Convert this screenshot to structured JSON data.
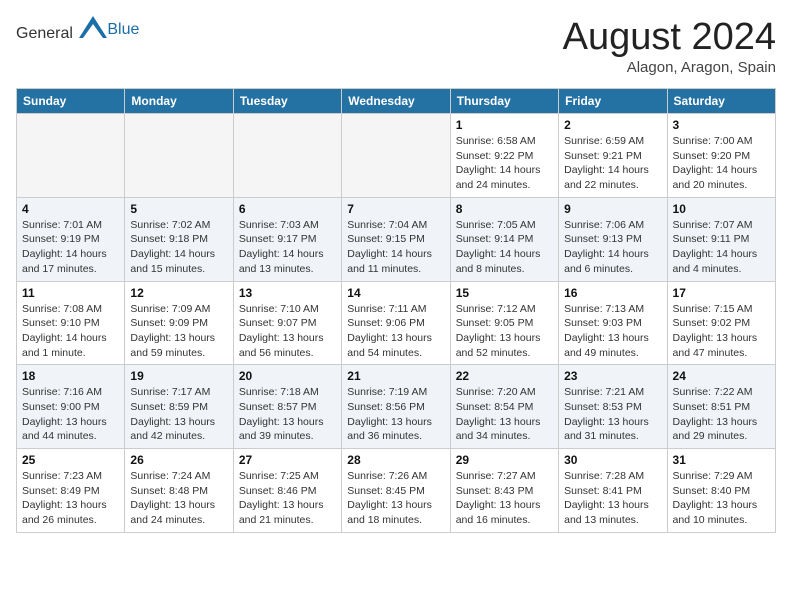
{
  "header": {
    "logo_general": "General",
    "logo_blue": "Blue",
    "month_year": "August 2024",
    "location": "Alagon, Aragon, Spain"
  },
  "days_of_week": [
    "Sunday",
    "Monday",
    "Tuesday",
    "Wednesday",
    "Thursday",
    "Friday",
    "Saturday"
  ],
  "weeks": [
    [
      {
        "day": "",
        "sunrise": "",
        "sunset": "",
        "daylight": "",
        "empty": true
      },
      {
        "day": "",
        "sunrise": "",
        "sunset": "",
        "daylight": "",
        "empty": true
      },
      {
        "day": "",
        "sunrise": "",
        "sunset": "",
        "daylight": "",
        "empty": true
      },
      {
        "day": "",
        "sunrise": "",
        "sunset": "",
        "daylight": "",
        "empty": true
      },
      {
        "day": "1",
        "sunrise": "Sunrise: 6:58 AM",
        "sunset": "Sunset: 9:22 PM",
        "daylight": "Daylight: 14 hours and 24 minutes.",
        "empty": false
      },
      {
        "day": "2",
        "sunrise": "Sunrise: 6:59 AM",
        "sunset": "Sunset: 9:21 PM",
        "daylight": "Daylight: 14 hours and 22 minutes.",
        "empty": false
      },
      {
        "day": "3",
        "sunrise": "Sunrise: 7:00 AM",
        "sunset": "Sunset: 9:20 PM",
        "daylight": "Daylight: 14 hours and 20 minutes.",
        "empty": false
      }
    ],
    [
      {
        "day": "4",
        "sunrise": "Sunrise: 7:01 AM",
        "sunset": "Sunset: 9:19 PM",
        "daylight": "Daylight: 14 hours and 17 minutes.",
        "empty": false
      },
      {
        "day": "5",
        "sunrise": "Sunrise: 7:02 AM",
        "sunset": "Sunset: 9:18 PM",
        "daylight": "Daylight: 14 hours and 15 minutes.",
        "empty": false
      },
      {
        "day": "6",
        "sunrise": "Sunrise: 7:03 AM",
        "sunset": "Sunset: 9:17 PM",
        "daylight": "Daylight: 14 hours and 13 minutes.",
        "empty": false
      },
      {
        "day": "7",
        "sunrise": "Sunrise: 7:04 AM",
        "sunset": "Sunset: 9:15 PM",
        "daylight": "Daylight: 14 hours and 11 minutes.",
        "empty": false
      },
      {
        "day": "8",
        "sunrise": "Sunrise: 7:05 AM",
        "sunset": "Sunset: 9:14 PM",
        "daylight": "Daylight: 14 hours and 8 minutes.",
        "empty": false
      },
      {
        "day": "9",
        "sunrise": "Sunrise: 7:06 AM",
        "sunset": "Sunset: 9:13 PM",
        "daylight": "Daylight: 14 hours and 6 minutes.",
        "empty": false
      },
      {
        "day": "10",
        "sunrise": "Sunrise: 7:07 AM",
        "sunset": "Sunset: 9:11 PM",
        "daylight": "Daylight: 14 hours and 4 minutes.",
        "empty": false
      }
    ],
    [
      {
        "day": "11",
        "sunrise": "Sunrise: 7:08 AM",
        "sunset": "Sunset: 9:10 PM",
        "daylight": "Daylight: 14 hours and 1 minute.",
        "empty": false
      },
      {
        "day": "12",
        "sunrise": "Sunrise: 7:09 AM",
        "sunset": "Sunset: 9:09 PM",
        "daylight": "Daylight: 13 hours and 59 minutes.",
        "empty": false
      },
      {
        "day": "13",
        "sunrise": "Sunrise: 7:10 AM",
        "sunset": "Sunset: 9:07 PM",
        "daylight": "Daylight: 13 hours and 56 minutes.",
        "empty": false
      },
      {
        "day": "14",
        "sunrise": "Sunrise: 7:11 AM",
        "sunset": "Sunset: 9:06 PM",
        "daylight": "Daylight: 13 hours and 54 minutes.",
        "empty": false
      },
      {
        "day": "15",
        "sunrise": "Sunrise: 7:12 AM",
        "sunset": "Sunset: 9:05 PM",
        "daylight": "Daylight: 13 hours and 52 minutes.",
        "empty": false
      },
      {
        "day": "16",
        "sunrise": "Sunrise: 7:13 AM",
        "sunset": "Sunset: 9:03 PM",
        "daylight": "Daylight: 13 hours and 49 minutes.",
        "empty": false
      },
      {
        "day": "17",
        "sunrise": "Sunrise: 7:15 AM",
        "sunset": "Sunset: 9:02 PM",
        "daylight": "Daylight: 13 hours and 47 minutes.",
        "empty": false
      }
    ],
    [
      {
        "day": "18",
        "sunrise": "Sunrise: 7:16 AM",
        "sunset": "Sunset: 9:00 PM",
        "daylight": "Daylight: 13 hours and 44 minutes.",
        "empty": false
      },
      {
        "day": "19",
        "sunrise": "Sunrise: 7:17 AM",
        "sunset": "Sunset: 8:59 PM",
        "daylight": "Daylight: 13 hours and 42 minutes.",
        "empty": false
      },
      {
        "day": "20",
        "sunrise": "Sunrise: 7:18 AM",
        "sunset": "Sunset: 8:57 PM",
        "daylight": "Daylight: 13 hours and 39 minutes.",
        "empty": false
      },
      {
        "day": "21",
        "sunrise": "Sunrise: 7:19 AM",
        "sunset": "Sunset: 8:56 PM",
        "daylight": "Daylight: 13 hours and 36 minutes.",
        "empty": false
      },
      {
        "day": "22",
        "sunrise": "Sunrise: 7:20 AM",
        "sunset": "Sunset: 8:54 PM",
        "daylight": "Daylight: 13 hours and 34 minutes.",
        "empty": false
      },
      {
        "day": "23",
        "sunrise": "Sunrise: 7:21 AM",
        "sunset": "Sunset: 8:53 PM",
        "daylight": "Daylight: 13 hours and 31 minutes.",
        "empty": false
      },
      {
        "day": "24",
        "sunrise": "Sunrise: 7:22 AM",
        "sunset": "Sunset: 8:51 PM",
        "daylight": "Daylight: 13 hours and 29 minutes.",
        "empty": false
      }
    ],
    [
      {
        "day": "25",
        "sunrise": "Sunrise: 7:23 AM",
        "sunset": "Sunset: 8:49 PM",
        "daylight": "Daylight: 13 hours and 26 minutes.",
        "empty": false
      },
      {
        "day": "26",
        "sunrise": "Sunrise: 7:24 AM",
        "sunset": "Sunset: 8:48 PM",
        "daylight": "Daylight: 13 hours and 24 minutes.",
        "empty": false
      },
      {
        "day": "27",
        "sunrise": "Sunrise: 7:25 AM",
        "sunset": "Sunset: 8:46 PM",
        "daylight": "Daylight: 13 hours and 21 minutes.",
        "empty": false
      },
      {
        "day": "28",
        "sunrise": "Sunrise: 7:26 AM",
        "sunset": "Sunset: 8:45 PM",
        "daylight": "Daylight: 13 hours and 18 minutes.",
        "empty": false
      },
      {
        "day": "29",
        "sunrise": "Sunrise: 7:27 AM",
        "sunset": "Sunset: 8:43 PM",
        "daylight": "Daylight: 13 hours and 16 minutes.",
        "empty": false
      },
      {
        "day": "30",
        "sunrise": "Sunrise: 7:28 AM",
        "sunset": "Sunset: 8:41 PM",
        "daylight": "Daylight: 13 hours and 13 minutes.",
        "empty": false
      },
      {
        "day": "31",
        "sunrise": "Sunrise: 7:29 AM",
        "sunset": "Sunset: 8:40 PM",
        "daylight": "Daylight: 13 hours and 10 minutes.",
        "empty": false
      }
    ]
  ]
}
